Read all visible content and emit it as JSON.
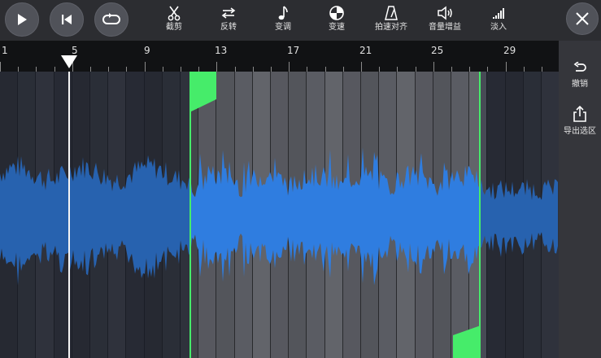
{
  "toolbar": {
    "play": {
      "icon": "play-icon"
    },
    "rewind": {
      "icon": "skip-back-icon"
    },
    "loop": {
      "icon": "loop-icon"
    },
    "tools": [
      {
        "label": "截剪",
        "icon": "scissors-icon"
      },
      {
        "label": "反转",
        "icon": "reverse-icon"
      },
      {
        "label": "变调",
        "icon": "music-note-icon"
      },
      {
        "label": "变速",
        "icon": "speed-dial-icon"
      },
      {
        "label": "拍速对齐",
        "icon": "metronome-icon"
      },
      {
        "label": "音量增益",
        "icon": "speaker-icon"
      },
      {
        "label": "淡入",
        "icon": "fade-in-icon"
      }
    ],
    "close": {
      "icon": "close-icon"
    }
  },
  "ruler": {
    "labels": [
      "1",
      "5",
      "9",
      "13",
      "17",
      "21",
      "25",
      "29"
    ]
  },
  "side_panel": {
    "undo_label": "撤销",
    "export_label": "导出选区"
  },
  "colors": {
    "waveform": "#2f7de0",
    "waveform_dim": "#1f63b8",
    "selection": "#46ec6a",
    "playhead": "#ffffff"
  }
}
